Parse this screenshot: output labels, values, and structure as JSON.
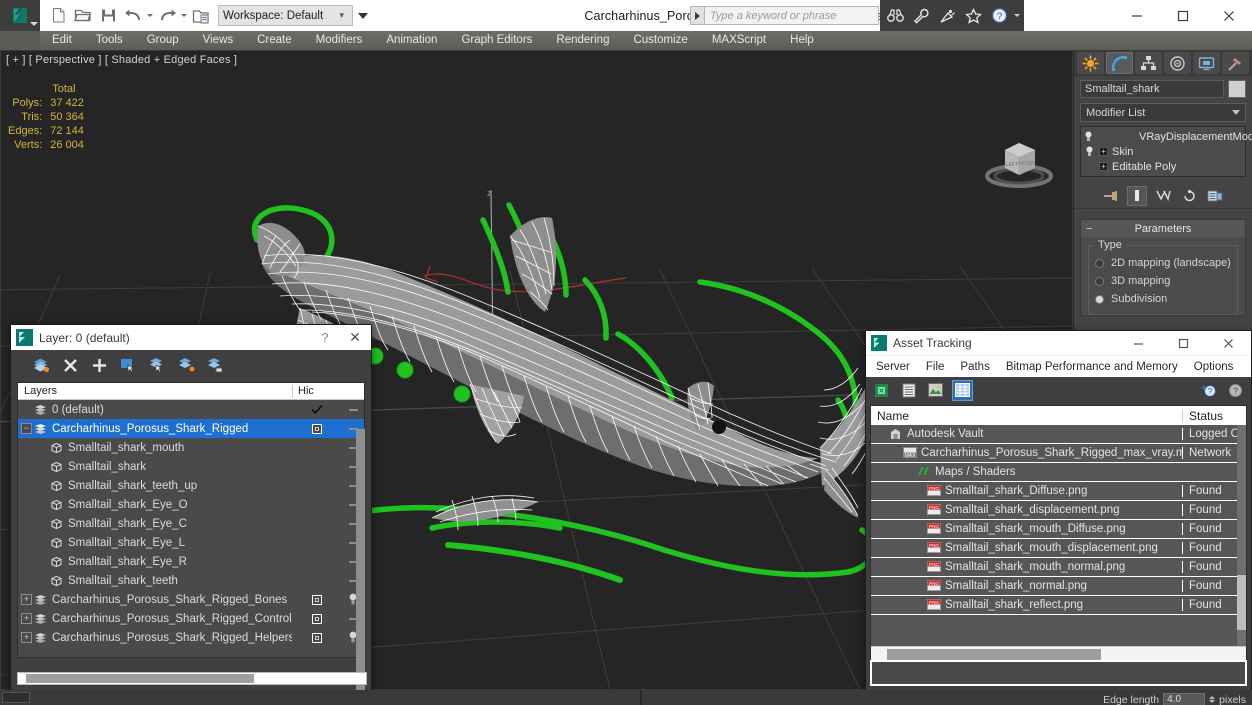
{
  "app": {
    "document_title": "Carcharhinus_Porosus_Shark_Rigged_max_vray.max",
    "workspace_label": "Workspace: Default",
    "logo_icon": "3dsmax-logo-icon"
  },
  "quick_access": [
    {
      "name": "new-file-icon",
      "label": "New"
    },
    {
      "name": "open-file-icon",
      "label": "Open"
    },
    {
      "name": "save-file-icon",
      "label": "Save"
    },
    {
      "name": "undo-icon",
      "label": "Undo"
    },
    {
      "name": "redo-icon",
      "label": "Redo"
    },
    {
      "name": "set-project-folder-icon",
      "label": "Set Project Folder"
    }
  ],
  "infocenter": {
    "placeholder": "Type a keyword or phrase",
    "icons": [
      {
        "name": "binoculars-icon",
        "label": "Search"
      },
      {
        "name": "wrench-icon",
        "label": "Communication Center"
      },
      {
        "name": "satellite-dish-icon",
        "label": "Subscription"
      },
      {
        "name": "star-icon",
        "label": "Favorites"
      },
      {
        "name": "help-icon",
        "label": "Help"
      }
    ]
  },
  "window_controls": [
    {
      "name": "minimize-button",
      "glyph": "minimize"
    },
    {
      "name": "maximize-button",
      "glyph": "maximize"
    },
    {
      "name": "close-button",
      "glyph": "close"
    }
  ],
  "menu": {
    "items": [
      "Edit",
      "Tools",
      "Group",
      "Views",
      "Create",
      "Modifiers",
      "Animation",
      "Graph Editors",
      "Rendering",
      "Customize",
      "MAXScript",
      "Help"
    ]
  },
  "viewport": {
    "label": "[ + ] [ Perspective ] [ Shaded + Edged Faces ]",
    "stats": {
      "header": "Total",
      "rows": [
        {
          "label": "Polys:",
          "value": "37 422"
        },
        {
          "label": "Tris:",
          "value": "50 364"
        },
        {
          "label": "Edges:",
          "value": "72 144"
        },
        {
          "label": "Verts:",
          "value": "26 004"
        }
      ]
    },
    "viewcube_name": "viewcube",
    "colors": {
      "background": "#252525",
      "grid": "#3b3b3b",
      "wireframe": "#ffffff",
      "rig_control": "#1fc21f",
      "axis_x": "#bb2b2b",
      "axis_z": "#9a9a9a"
    }
  },
  "command_panel": {
    "tabs": [
      {
        "name": "create-tab",
        "icon": "star-burst-icon",
        "active": false
      },
      {
        "name": "modify-tab",
        "icon": "bent-arc-icon",
        "active": true
      },
      {
        "name": "hierarchy-tab",
        "icon": "hierarchy-icon",
        "active": false
      },
      {
        "name": "motion-tab",
        "icon": "wheel-icon",
        "active": false
      },
      {
        "name": "display-tab",
        "icon": "monitor-icon",
        "active": false
      },
      {
        "name": "utilities-tab",
        "icon": "hammer-icon",
        "active": false
      }
    ],
    "object_name": "Smalltail_shark",
    "modifier_list_label": "Modifier List",
    "modifier_stack": [
      {
        "label": "VRayDisplacementMod",
        "has_bulb": true,
        "has_expand": false,
        "indent": true
      },
      {
        "label": "Skin",
        "has_bulb": true,
        "has_expand": true,
        "indent": false
      },
      {
        "label": "Editable Poly",
        "has_bulb": false,
        "has_expand": true,
        "indent": false
      }
    ],
    "stack_tools": [
      {
        "name": "pin-stack-icon"
      },
      {
        "name": "show-end-result-icon"
      },
      {
        "name": "make-unique-icon"
      },
      {
        "name": "remove-modifier-icon"
      },
      {
        "name": "configure-modifier-sets-icon"
      }
    ],
    "rollout": {
      "title": "Parameters",
      "group_title": "Type",
      "options": [
        {
          "label": "2D mapping (landscape)",
          "selected": false
        },
        {
          "label": "3D mapping",
          "selected": false
        },
        {
          "label": "Subdivision",
          "selected": true
        }
      ]
    }
  },
  "layer_dialog": {
    "title": "Layer: 0 (default)",
    "help_glyph": "?",
    "close_glyph": "✕",
    "toolbar": [
      {
        "name": "create-new-layer-icon"
      },
      {
        "name": "delete-layer-icon"
      },
      {
        "name": "add-selection-to-layer-icon"
      },
      {
        "name": "select-objects-in-layer-icon"
      },
      {
        "name": "select-highlighted-objects-icon"
      },
      {
        "name": "highlight-selected-objects-icon"
      },
      {
        "name": "hide-unhide-layer-icon"
      }
    ],
    "columns": [
      "Layers",
      "Hic",
      ""
    ],
    "rows": [
      {
        "name": "0 (default)",
        "level": 1,
        "icon": "layer-icon",
        "expander": "",
        "selected": false,
        "hide_state": "check",
        "freeze": "dash"
      },
      {
        "name": "Carcharhinus_Porosus_Shark_Rigged",
        "level": 1,
        "icon": "layer-icon",
        "expander": "-",
        "selected": true,
        "hide_state": "box",
        "freeze": "dash"
      },
      {
        "name": "Smalltail_shark_mouth",
        "level": 2,
        "icon": "object-icon",
        "expander": "",
        "selected": false,
        "hide_state": "",
        "freeze": "dash"
      },
      {
        "name": "Smalltail_shark",
        "level": 2,
        "icon": "object-icon",
        "expander": "",
        "selected": false,
        "hide_state": "",
        "freeze": "dash"
      },
      {
        "name": "Smalltail_shark_teeth_up",
        "level": 2,
        "icon": "object-icon",
        "expander": "",
        "selected": false,
        "hide_state": "",
        "freeze": "dash"
      },
      {
        "name": "Smalltail_shark_Eye_O",
        "level": 2,
        "icon": "object-icon",
        "expander": "",
        "selected": false,
        "hide_state": "",
        "freeze": "dash"
      },
      {
        "name": "Smalltail_shark_Eye_C",
        "level": 2,
        "icon": "object-icon",
        "expander": "",
        "selected": false,
        "hide_state": "",
        "freeze": "dash"
      },
      {
        "name": "Smalltail_shark_Eye_L",
        "level": 2,
        "icon": "object-icon",
        "expander": "",
        "selected": false,
        "hide_state": "",
        "freeze": "dash"
      },
      {
        "name": "Smalltail_shark_Eye_R",
        "level": 2,
        "icon": "object-icon",
        "expander": "",
        "selected": false,
        "hide_state": "",
        "freeze": "dash"
      },
      {
        "name": "Smalltail_shark_teeth",
        "level": 2,
        "icon": "object-icon",
        "expander": "",
        "selected": false,
        "hide_state": "",
        "freeze": "dash"
      },
      {
        "name": "Carcharhinus_Porosus_Shark_Rigged_Bones",
        "level": 1,
        "icon": "layer-icon",
        "expander": "+",
        "selected": false,
        "hide_state": "box",
        "freeze": "bulb"
      },
      {
        "name": "Carcharhinus_Porosus_Shark_Rigged_Controls",
        "level": 1,
        "icon": "layer-icon",
        "expander": "+",
        "selected": false,
        "hide_state": "box",
        "freeze": "dash"
      },
      {
        "name": "Carcharhinus_Porosus_Shark_Rigged_Helpers",
        "level": 1,
        "icon": "layer-icon",
        "expander": "+",
        "selected": false,
        "hide_state": "box",
        "freeze": "bulb"
      }
    ]
  },
  "asset_tracking": {
    "title": "Asset Tracking",
    "menu": [
      "Server",
      "File",
      "Paths",
      "Bitmap Performance and Memory",
      "Options"
    ],
    "toolbar": [
      {
        "name": "refresh-assets-icon",
        "active": false
      },
      {
        "name": "list-view-icon",
        "active": false
      },
      {
        "name": "thumbnail-view-icon",
        "active": false
      },
      {
        "name": "grid-view-icon",
        "active": true
      }
    ],
    "help_icons": [
      {
        "name": "new-help-icon"
      },
      {
        "name": "help-icon"
      }
    ],
    "columns": [
      "Name",
      "Status"
    ],
    "rows": [
      {
        "name": "Autodesk Vault",
        "status": "Logged O",
        "indent": 1,
        "icon": "vault-icon"
      },
      {
        "name": "Carcharhinus_Porosus_Shark_Rigged_max_vray.max",
        "status": "Network",
        "indent": 2,
        "icon": "max-file-icon"
      },
      {
        "name": "Maps / Shaders",
        "status": "",
        "indent": 3,
        "icon": "maps-shaders-icon"
      },
      {
        "name": "Smalltail_shark_Diffuse.png",
        "status": "Found",
        "indent": 4,
        "icon": "png-file-icon"
      },
      {
        "name": "Smalltail_shark_displacement.png",
        "status": "Found",
        "indent": 4,
        "icon": "png-file-icon"
      },
      {
        "name": "Smalltail_shark_mouth_Diffuse.png",
        "status": "Found",
        "indent": 4,
        "icon": "png-file-icon"
      },
      {
        "name": "Smalltail_shark_mouth_displacement.png",
        "status": "Found",
        "indent": 4,
        "icon": "png-file-icon"
      },
      {
        "name": "Smalltail_shark_mouth_normal.png",
        "status": "Found",
        "indent": 4,
        "icon": "png-file-icon"
      },
      {
        "name": "Smalltail_shark_normal.png",
        "status": "Found",
        "indent": 4,
        "icon": "png-file-icon"
      },
      {
        "name": "Smalltail_shark_reflect.png",
        "status": "Found",
        "indent": 4,
        "icon": "png-file-icon"
      }
    ]
  },
  "status_bar": {
    "edge_length_label": "Edge length",
    "edge_length_value": "4.0",
    "edge_length_units": "pixels"
  }
}
